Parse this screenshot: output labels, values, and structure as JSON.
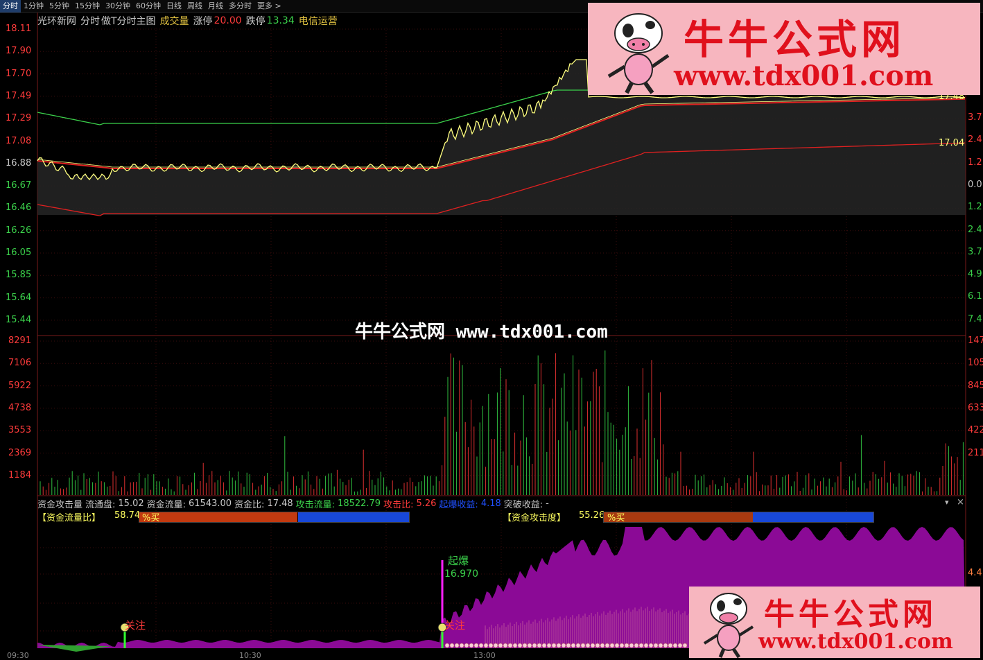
{
  "toolbar": {
    "periods": [
      "分时",
      "1分钟",
      "5分钟",
      "15分钟",
      "30分钟",
      "60分钟",
      "日线",
      "周线",
      "月线",
      "多分时",
      "更多 >"
    ],
    "active": "分时"
  },
  "info": {
    "site": "光环新网",
    "mode": "分时",
    "indicator": "做T分时主图",
    "volume_label": "成交量",
    "up_limit_label": "涨停",
    "up_limit_value": "20.00",
    "down_limit_label": "跌停",
    "down_limit_value": "13.34",
    "sector": "电信运营"
  },
  "price_axis": {
    "left_labels": [
      "18.11",
      "17.90",
      "17.70",
      "17.49",
      "17.29",
      "17.08",
      "16.88",
      "16.67",
      "16.46",
      "16.26",
      "16.05",
      "15.85",
      "15.64",
      "15.44"
    ],
    "right_labels": [
      "3.7",
      "2.4",
      "1.2",
      "0.0",
      "1.2",
      "2.4",
      "3.7",
      "4.9",
      "6.1",
      "7.4"
    ],
    "line_tags": [
      "17.48",
      "17.04"
    ]
  },
  "volume_axis": {
    "left_labels": [
      "8291",
      "7106",
      "5922",
      "4738",
      "3553",
      "2369",
      "1184"
    ],
    "right_labels": [
      "147",
      "105",
      "845",
      "633",
      "422",
      "211"
    ]
  },
  "sub_panel": {
    "name": "资金攻击量",
    "float_label": "流通盘:",
    "float_value": "15.02",
    "fund_flow_label": "资金流量:",
    "fund_flow_value": "61543.00",
    "fund_ratio_label": "资金比:",
    "fund_ratio_value": "17.48",
    "attack_flow_label": "攻击流量:",
    "attack_flow_value": "18522.79",
    "attack_ratio_label": "攻击比:",
    "attack_ratio_value": "5.26",
    "burst_gain_label": "起爆收益:",
    "burst_gain_value": "4.18",
    "breakout_gain_label": "突破收益:",
    "breakout_gain_value": "-",
    "flow_ratio_label": "【资金流量比】",
    "flow_ratio_value": "58.74",
    "flow_ratio_unit": "%买",
    "flow_ratio_fraction": 0.5874,
    "attack_degree_label": "【资金攻击度】",
    "attack_degree_value": "55.26",
    "attack_degree_unit": "%买",
    "attack_degree_fraction": 0.5526,
    "burst_label": "起爆",
    "burst_price": "16.970",
    "watch_label": "关注",
    "right_tag": "4.4",
    "time_labels": [
      "09:30",
      "10:30",
      "13:00"
    ]
  },
  "promo": {
    "title": "牛牛公式网",
    "url": "www.tdx001.com",
    "watermark": "牛牛公式网 www.tdx001.com"
  },
  "colors": {
    "up": "#ff3b3b",
    "down": "#3bd14b",
    "price_line": "#ffff80",
    "avg_line": "#e02020",
    "purple_area": "#8b0a96",
    "bar_red": "#c23a10",
    "bar_blue": "#1848d8"
  }
}
